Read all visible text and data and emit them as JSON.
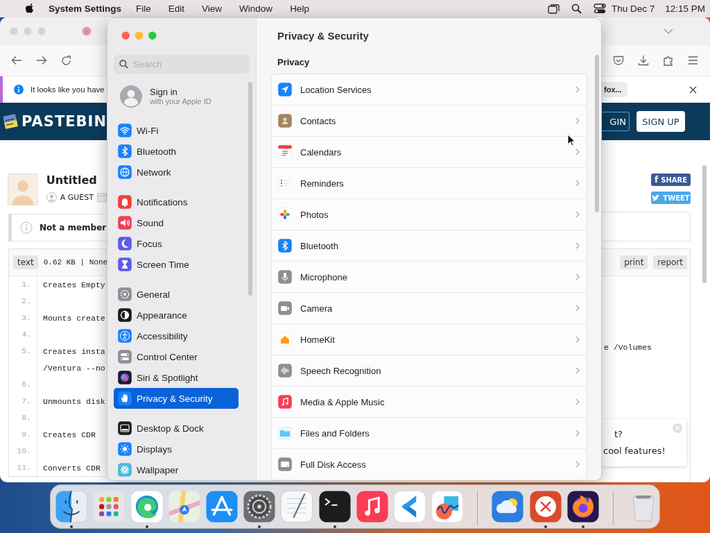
{
  "menu_bar": {
    "app": "System Settings",
    "menus": [
      "File",
      "Edit",
      "View",
      "Window",
      "Help"
    ],
    "date": "Thu Dec 7",
    "time": "12:15 PM"
  },
  "browser": {
    "notice": "It looks like you have",
    "notice_chip": "fox...",
    "brand": "PASTEBIN",
    "login": "GIN",
    "signup": "SIGN UP",
    "paste_title": "Untitled",
    "author": "A GUEST",
    "member_notice": "Not a member",
    "share_mark": "f",
    "share": "SHARE",
    "tweet": "TWEET",
    "syntax": "text",
    "meta": "0.62 KB | None",
    "actions": [
      "print",
      "report"
    ],
    "lines": [
      {
        "number": "1.",
        "text": "Creates Empty"
      },
      {
        "number": "2."
      },
      {
        "number": "3.",
        "text": "Mounts create"
      },
      {
        "number": "4."
      },
      {
        "number": "5.",
        "text": "Creates insta"
      },
      {
        "text": "/Ventura --no"
      },
      {
        "number": "6."
      },
      {
        "number": "7.",
        "text": "Unmounts disk"
      },
      {
        "number": "8."
      },
      {
        "number": "9.",
        "text": "Creates CDR"
      },
      {
        "number": "10."
      },
      {
        "number": "11.",
        "text": "Converts CDR"
      }
    ],
    "line_tail": "e /Volumes",
    "popup": [
      "t?",
      "cool features!"
    ]
  },
  "settings": {
    "search": {
      "placeholder": "Search"
    },
    "account": {
      "title": "Sign in",
      "subtitle": "with your Apple ID"
    },
    "groups": [
      {
        "items": [
          {
            "label": "Wi-Fi",
            "selected": false
          },
          {
            "label": "Bluetooth",
            "selected": false
          },
          {
            "label": "Network",
            "selected": false
          }
        ]
      },
      {
        "items": [
          {
            "label": "Notifications",
            "selected": false
          },
          {
            "label": "Sound",
            "selected": false
          },
          {
            "label": "Focus",
            "selected": false
          },
          {
            "label": "Screen Time",
            "selected": false
          }
        ]
      },
      {
        "items": [
          {
            "label": "General",
            "selected": false
          },
          {
            "label": "Appearance",
            "selected": false
          },
          {
            "label": "Accessibility",
            "selected": false
          },
          {
            "label": "Control Center",
            "selected": false
          },
          {
            "label": "Siri & Spotlight",
            "selected": false
          },
          {
            "label": "Privacy & Security",
            "selected": true
          }
        ]
      },
      {
        "items": [
          {
            "label": "Desktop & Dock",
            "selected": false
          },
          {
            "label": "Displays",
            "selected": false
          },
          {
            "label": "Wallpaper",
            "selected": false
          }
        ]
      }
    ],
    "pane": {
      "title": "Privacy & Security",
      "section": "Privacy",
      "rows": [
        {
          "label": "Location Services"
        },
        {
          "label": "Contacts"
        },
        {
          "label": "Calendars"
        },
        {
          "label": "Reminders"
        },
        {
          "label": "Photos"
        },
        {
          "label": "Bluetooth"
        },
        {
          "label": "Microphone"
        },
        {
          "label": "Camera"
        },
        {
          "label": "HomeKit"
        },
        {
          "label": "Speech Recognition"
        },
        {
          "label": "Media & Apple Music"
        },
        {
          "label": "Files and Folders"
        },
        {
          "label": "Full Disk Access"
        }
      ]
    }
  },
  "dock": {
    "groups": [
      {
        "apps": [
          {
            "running": true
          },
          {
            "running": false
          },
          {
            "running": true
          },
          {
            "running": false
          },
          {
            "running": false
          },
          {
            "running": true
          },
          {
            "running": false
          },
          {
            "running": true
          },
          {
            "running": false
          },
          {
            "running": false
          },
          {
            "running": false
          }
        ]
      },
      {
        "apps": [
          {
            "running": false
          },
          {
            "running": true
          },
          {
            "running": true
          }
        ]
      },
      {
        "apps": [
          {
            "running": false
          }
        ]
      }
    ]
  }
}
